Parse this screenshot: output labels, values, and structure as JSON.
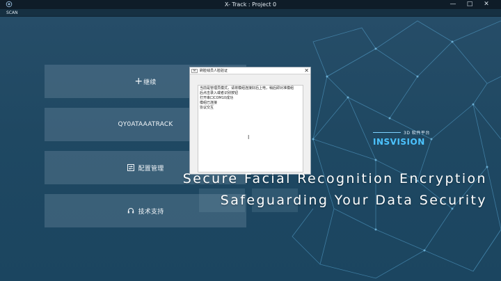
{
  "window": {
    "title": "X- Track : Project 0",
    "minimize": "—",
    "maximize": "□",
    "close": "✕"
  },
  "menu": {
    "scan": "SCAN"
  },
  "panels": [
    {
      "label": "继续",
      "icon": "plus-icon"
    },
    {
      "label": "QY0ATAAATRACK"
    },
    {
      "label": "配置管理",
      "icon": "sliders-icon"
    },
    {
      "label": "技术支持",
      "icon": "headset-icon"
    }
  ],
  "dialog": {
    "title": "刷脸钱员人脸验证",
    "icon_text": "M",
    "close": "✕",
    "log": [
      "当前是管理员模式，请将模组连接好后上电，稍后即对准模组",
      "后点击录入或者识别按钮",
      "打开串口COM10成功",
      "模组已连接",
      "协议交互"
    ]
  },
  "brand": {
    "sub": "3D 软件平台",
    "main": "INSVISION",
    "accent": "#4cc3ff"
  },
  "caption": {
    "line1": "Secure Facial Recognition Encryption",
    "line2": "Safeguarding Your Data Security"
  }
}
